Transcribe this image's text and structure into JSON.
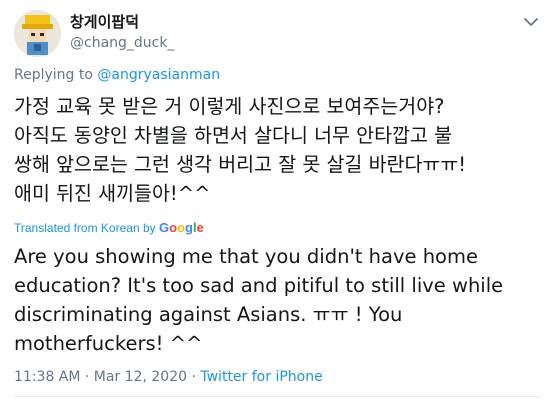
{
  "author": {
    "display_name": "창게이팝덕",
    "handle": "@chang_duck_"
  },
  "reply": {
    "prefix": "Replying to ",
    "mention": "@angryasianman"
  },
  "tweet_text": "가정 교육 못 받은 거 이렇게 사진으로 보여주는거야?\n아직도 동양인 차별을 하면서 살다니 너무 안타깝고 불\n쌍해 앞으로는 그런 생각 버리고 잘 못 살길 바란다ㅠㅠ!\n애미 뒤진 새끼들아!^^",
  "translation": {
    "label": "Translated from Korean by ",
    "google_g1": "G",
    "google_o1": "o",
    "google_o2": "o",
    "google_g2": "g",
    "google_l": "l",
    "google_e": "e",
    "text": "Are you showing me that you didn't have home education? It's too sad and pitiful to still live while discriminating against Asians. ㅠㅠ ! You motherfuckers! ^^"
  },
  "meta": {
    "timestamp": "11:38 AM · Mar 12, 2020 · ",
    "source": "Twitter for iPhone"
  },
  "icons": {
    "caret": "chevron-down-icon"
  },
  "colors": {
    "link": "#1b95e0",
    "secondary": "#657786"
  }
}
